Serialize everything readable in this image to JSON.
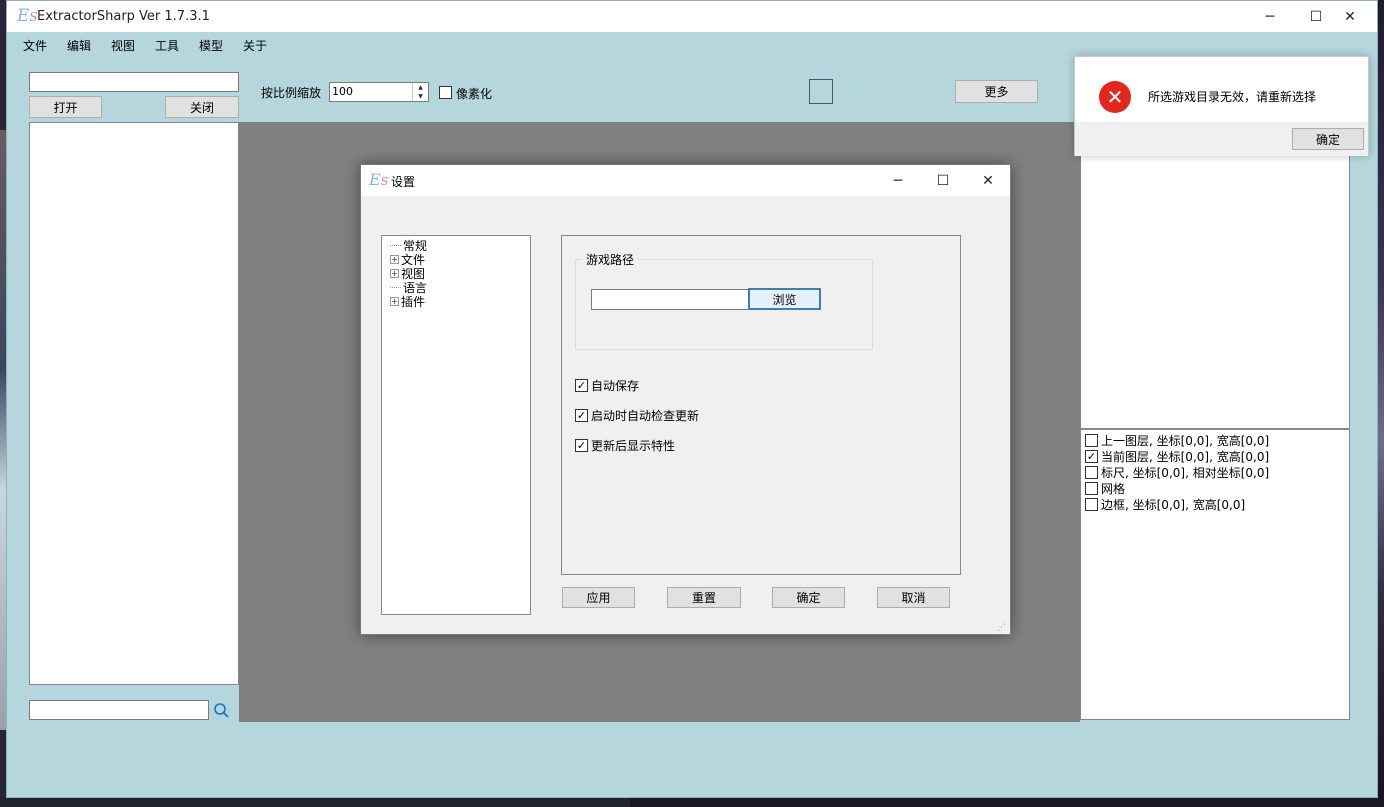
{
  "window": {
    "title": "ExtractorSharp Ver 1.7.3.1",
    "logo_e": "E",
    "logo_s": "S",
    "controls": {
      "minimize": "─",
      "maximize": "☐",
      "close": "✕"
    }
  },
  "menu": [
    "文件",
    "编辑",
    "视图",
    "工具",
    "模型",
    "关于"
  ],
  "left_panel": {
    "search_top_value": "",
    "open_label": "打开",
    "close_label": "关闭",
    "search_bottom_value": ""
  },
  "toolbar": {
    "zoom_label": "按比例缩放",
    "zoom_value": "100",
    "pixelate_label": "像素化",
    "pixelate_checked": false,
    "more_label": "更多"
  },
  "layers": [
    {
      "label": "上一图层, 坐标[0,0], 宽高[0,0]",
      "checked": false
    },
    {
      "label": "当前图层, 坐标[0,0], 宽高[0,0]",
      "checked": true
    },
    {
      "label": "标尺, 坐标[0,0], 相对坐标[0,0]",
      "checked": false
    },
    {
      "label": "网格",
      "checked": false
    },
    {
      "label": "边框, 坐标[0,0], 宽高[0,0]",
      "checked": false
    }
  ],
  "error_popup": {
    "message": "所选游戏目录无效，请重新选择",
    "ok_label": "确定"
  },
  "settings_dialog": {
    "title": "设置",
    "tree": [
      {
        "label": "常规",
        "expandable": false
      },
      {
        "label": "文件",
        "expandable": true
      },
      {
        "label": "视图",
        "expandable": true
      },
      {
        "label": "语言",
        "expandable": false
      },
      {
        "label": "插件",
        "expandable": true
      }
    ],
    "game_path_group": "游戏路径",
    "game_path_value": "",
    "browse_label": "浏览",
    "options": [
      {
        "label": "自动保存",
        "checked": true
      },
      {
        "label": "启动时自动检查更新",
        "checked": true
      },
      {
        "label": "更新后显示特性",
        "checked": true
      }
    ],
    "buttons": {
      "apply": "应用",
      "reset": "重置",
      "ok": "确定",
      "cancel": "取消"
    }
  },
  "colors": {
    "main_bg": "#b5d6dd",
    "canvas_bg": "#808080",
    "error_red": "#e0281e",
    "focus_blue": "#3c7fb1"
  }
}
